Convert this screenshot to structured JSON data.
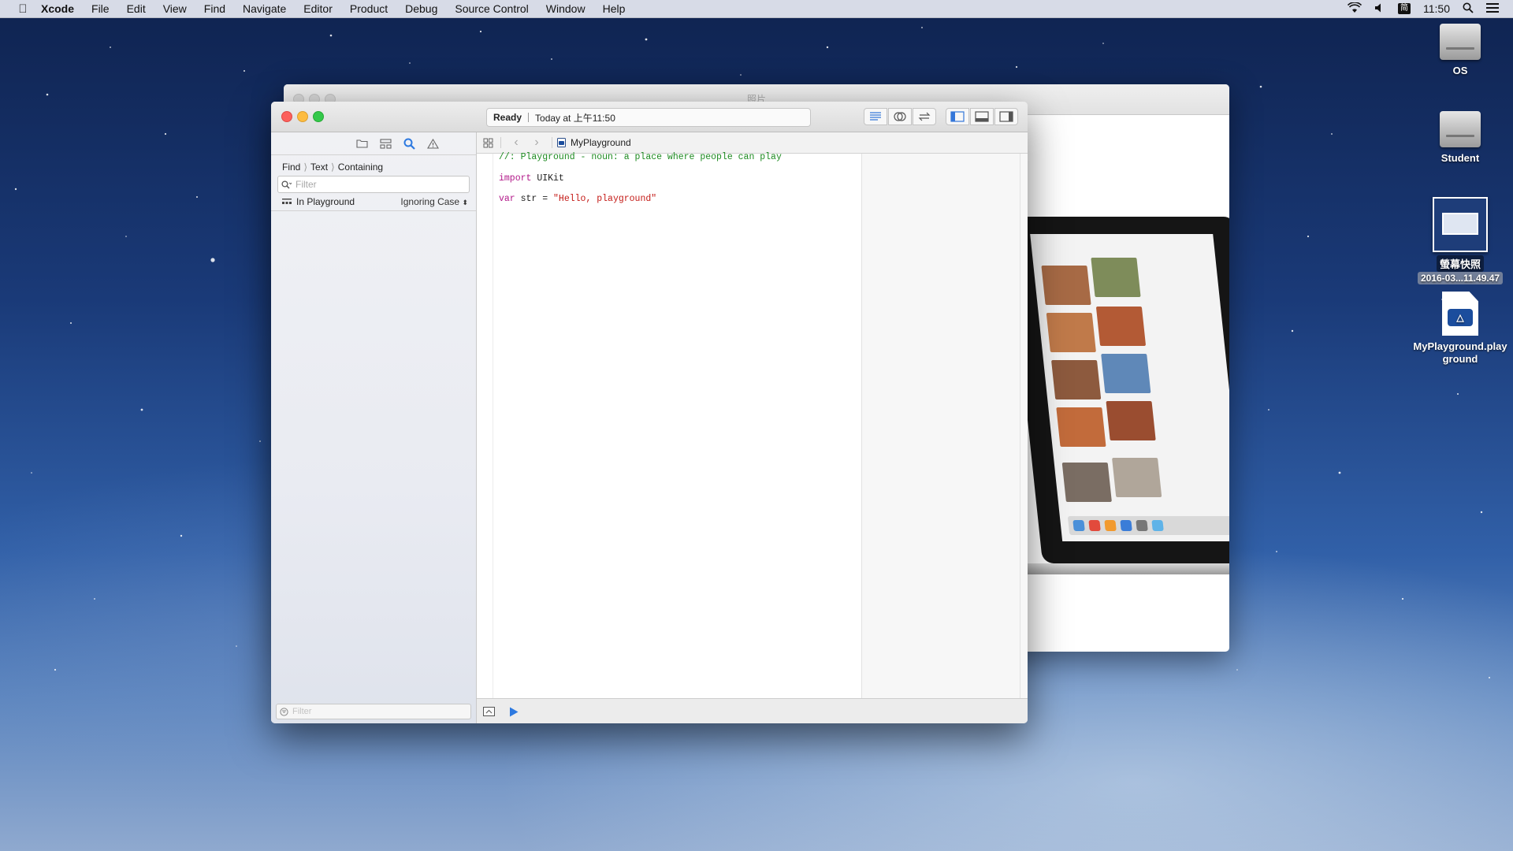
{
  "menubar": {
    "app_name": "Xcode",
    "menus": [
      "File",
      "Edit",
      "View",
      "Find",
      "Navigate",
      "Editor",
      "Product",
      "Debug",
      "Source Control",
      "Window",
      "Help"
    ],
    "clock": "11:50",
    "input_method": "简"
  },
  "desktop_icons": [
    {
      "label": "OS",
      "icon": "hard-disk-icon"
    },
    {
      "label": "Student",
      "icon": "hard-disk-icon"
    },
    {
      "label_line1": "螢幕快照",
      "label_line2": "2016-03...11.49.47",
      "icon": "screenshot-file-icon"
    },
    {
      "label": "MyPlayground.playground",
      "icon": "playground-file-icon"
    }
  ],
  "photos_window": {
    "title": "照片"
  },
  "xcode": {
    "activity": {
      "status": "Ready",
      "timestamp": "Today at 上午11:50"
    },
    "navigator": {
      "find_path": [
        "Find",
        "Text",
        "Containing"
      ],
      "filter_placeholder": "Filter",
      "scope": "In Playground",
      "case_option": "Ignoring Case",
      "bottom_filter_placeholder": "Filter"
    },
    "jumpbar": {
      "file": "MyPlayground"
    },
    "code": {
      "line1": "//: Playground - noun: a place where people can play",
      "line3_kw": "import",
      "line3_rest": " UIKit",
      "line5_kw": "var",
      "line5_mid": " str = ",
      "line5_str": "\"Hello, playground\""
    }
  }
}
